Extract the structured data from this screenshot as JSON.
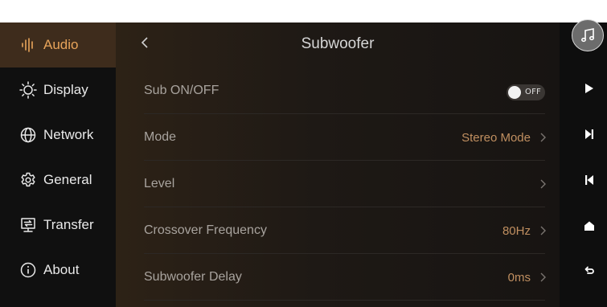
{
  "sidebar": {
    "items": [
      {
        "label": "Audio",
        "icon": "audio-wave-icon",
        "active": true
      },
      {
        "label": "Display",
        "icon": "sun-icon",
        "active": false
      },
      {
        "label": "Network",
        "icon": "globe-icon",
        "active": false
      },
      {
        "label": "General",
        "icon": "gear-icon",
        "active": false
      },
      {
        "label": "Transfer",
        "icon": "transfer-icon",
        "active": false
      },
      {
        "label": "About",
        "icon": "info-icon",
        "active": false
      }
    ]
  },
  "header": {
    "title": "Subwoofer",
    "back_icon": "chevron-left-icon"
  },
  "settings": [
    {
      "label": "Sub ON/OFF",
      "type": "toggle",
      "toggle_text": "OFF",
      "state": "off"
    },
    {
      "label": "Mode",
      "value": "Stereo Mode"
    },
    {
      "label": "Level",
      "value": ""
    },
    {
      "label": "Crossover Frequency",
      "value": "80Hz"
    },
    {
      "label": "Subwoofer Delay",
      "value": "0ms"
    }
  ],
  "player_controls": {
    "album_icon": "music-note-icon",
    "buttons": [
      "play-icon",
      "next-track-icon",
      "previous-track-icon",
      "home-icon",
      "return-icon"
    ]
  },
  "colors": {
    "accent": "#e8a45a",
    "active_bg": "#3e2c1c",
    "value_text": "#c08f60"
  }
}
